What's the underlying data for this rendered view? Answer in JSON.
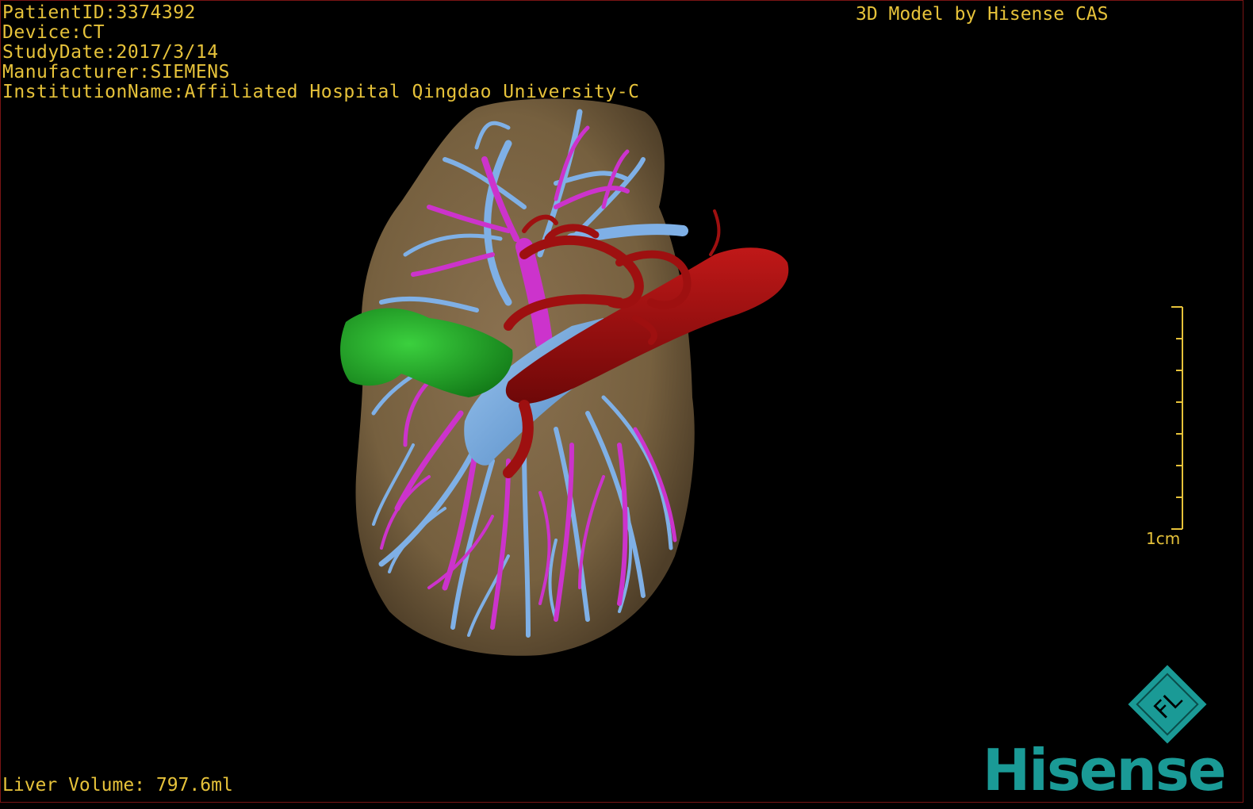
{
  "overlay": {
    "patient_id": "PatientID:3374392",
    "device": "Device:CT",
    "study_date": "StudyDate:2017/3/14",
    "manufacturer": "Manufacturer:SIEMENS",
    "institution": "InstitutionName:Affiliated Hospital Qingdao University-C",
    "model_credit": "3D Model by Hisense CAS",
    "liver_volume": "Liver Volume: 797.6ml"
  },
  "scale_bar": {
    "label": "1cm",
    "color": "#e6c23a"
  },
  "brand": {
    "logo_letters": "FL",
    "name": "Hisense",
    "color": "#1a9a96"
  },
  "model_colors": {
    "liver": "#7a6244",
    "portal_vein": "#7fb0e6",
    "hepatic_vein": "#cc33cc",
    "artery": "#9e1010",
    "lesion": "#1f9e26",
    "background": "#000000"
  }
}
